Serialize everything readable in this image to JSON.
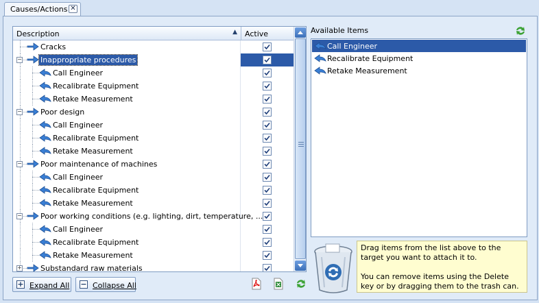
{
  "tab": {
    "label": "Causes/Actions",
    "close": "✕"
  },
  "grid": {
    "columns": {
      "description": "Description",
      "active": "Active",
      "sort_indicator": "▲"
    },
    "rows": [
      {
        "level": 0,
        "label": "Cracks",
        "active": true,
        "expander": ""
      },
      {
        "level": 0,
        "label": "Inappropriate procedures",
        "active": true,
        "expander": "−",
        "selected": true
      },
      {
        "level": 1,
        "label": "Call Engineer",
        "active": true
      },
      {
        "level": 1,
        "label": "Recalibrate Equipment",
        "active": true
      },
      {
        "level": 1,
        "label": "Retake Measurement",
        "active": true
      },
      {
        "level": 0,
        "label": "Poor design",
        "active": true,
        "expander": "−"
      },
      {
        "level": 1,
        "label": "Call Engineer",
        "active": true
      },
      {
        "level": 1,
        "label": "Recalibrate Equipment",
        "active": true
      },
      {
        "level": 1,
        "label": "Retake Measurement",
        "active": true
      },
      {
        "level": 0,
        "label": "Poor maintenance of machines",
        "active": true,
        "expander": "−"
      },
      {
        "level": 1,
        "label": "Call Engineer",
        "active": true
      },
      {
        "level": 1,
        "label": "Recalibrate Equipment",
        "active": true
      },
      {
        "level": 1,
        "label": "Retake Measurement",
        "active": true
      },
      {
        "level": 0,
        "label": "Poor working conditions (e.g. lighting, dirt, temperature, ...",
        "active": true,
        "expander": "−"
      },
      {
        "level": 1,
        "label": "Call Engineer",
        "active": true
      },
      {
        "level": 1,
        "label": "Recalibrate Equipment",
        "active": true
      },
      {
        "level": 1,
        "label": "Retake Measurement",
        "active": true
      },
      {
        "level": 0,
        "label": "Substandard raw materials",
        "active": true,
        "expander": "+"
      }
    ]
  },
  "buttons": {
    "expand_all": "Expand All",
    "collapse_all": "Collapse All",
    "expand_icon": "+",
    "collapse_icon": "−"
  },
  "available": {
    "title": "Available Items",
    "items": [
      {
        "label": "Call Engineer",
        "selected": true
      },
      {
        "label": "Recalibrate Equipment"
      },
      {
        "label": "Retake Measurement"
      }
    ]
  },
  "hint": {
    "line1": "Drag items from the list above to the target you want to attach it to.",
    "line2": "You can remove items using the Delete key or by dragging them to the trash can."
  },
  "colors": {
    "selection": "#2c5aa8",
    "panel": "#e0ebf8",
    "hint_bg": "#fffdd0"
  }
}
